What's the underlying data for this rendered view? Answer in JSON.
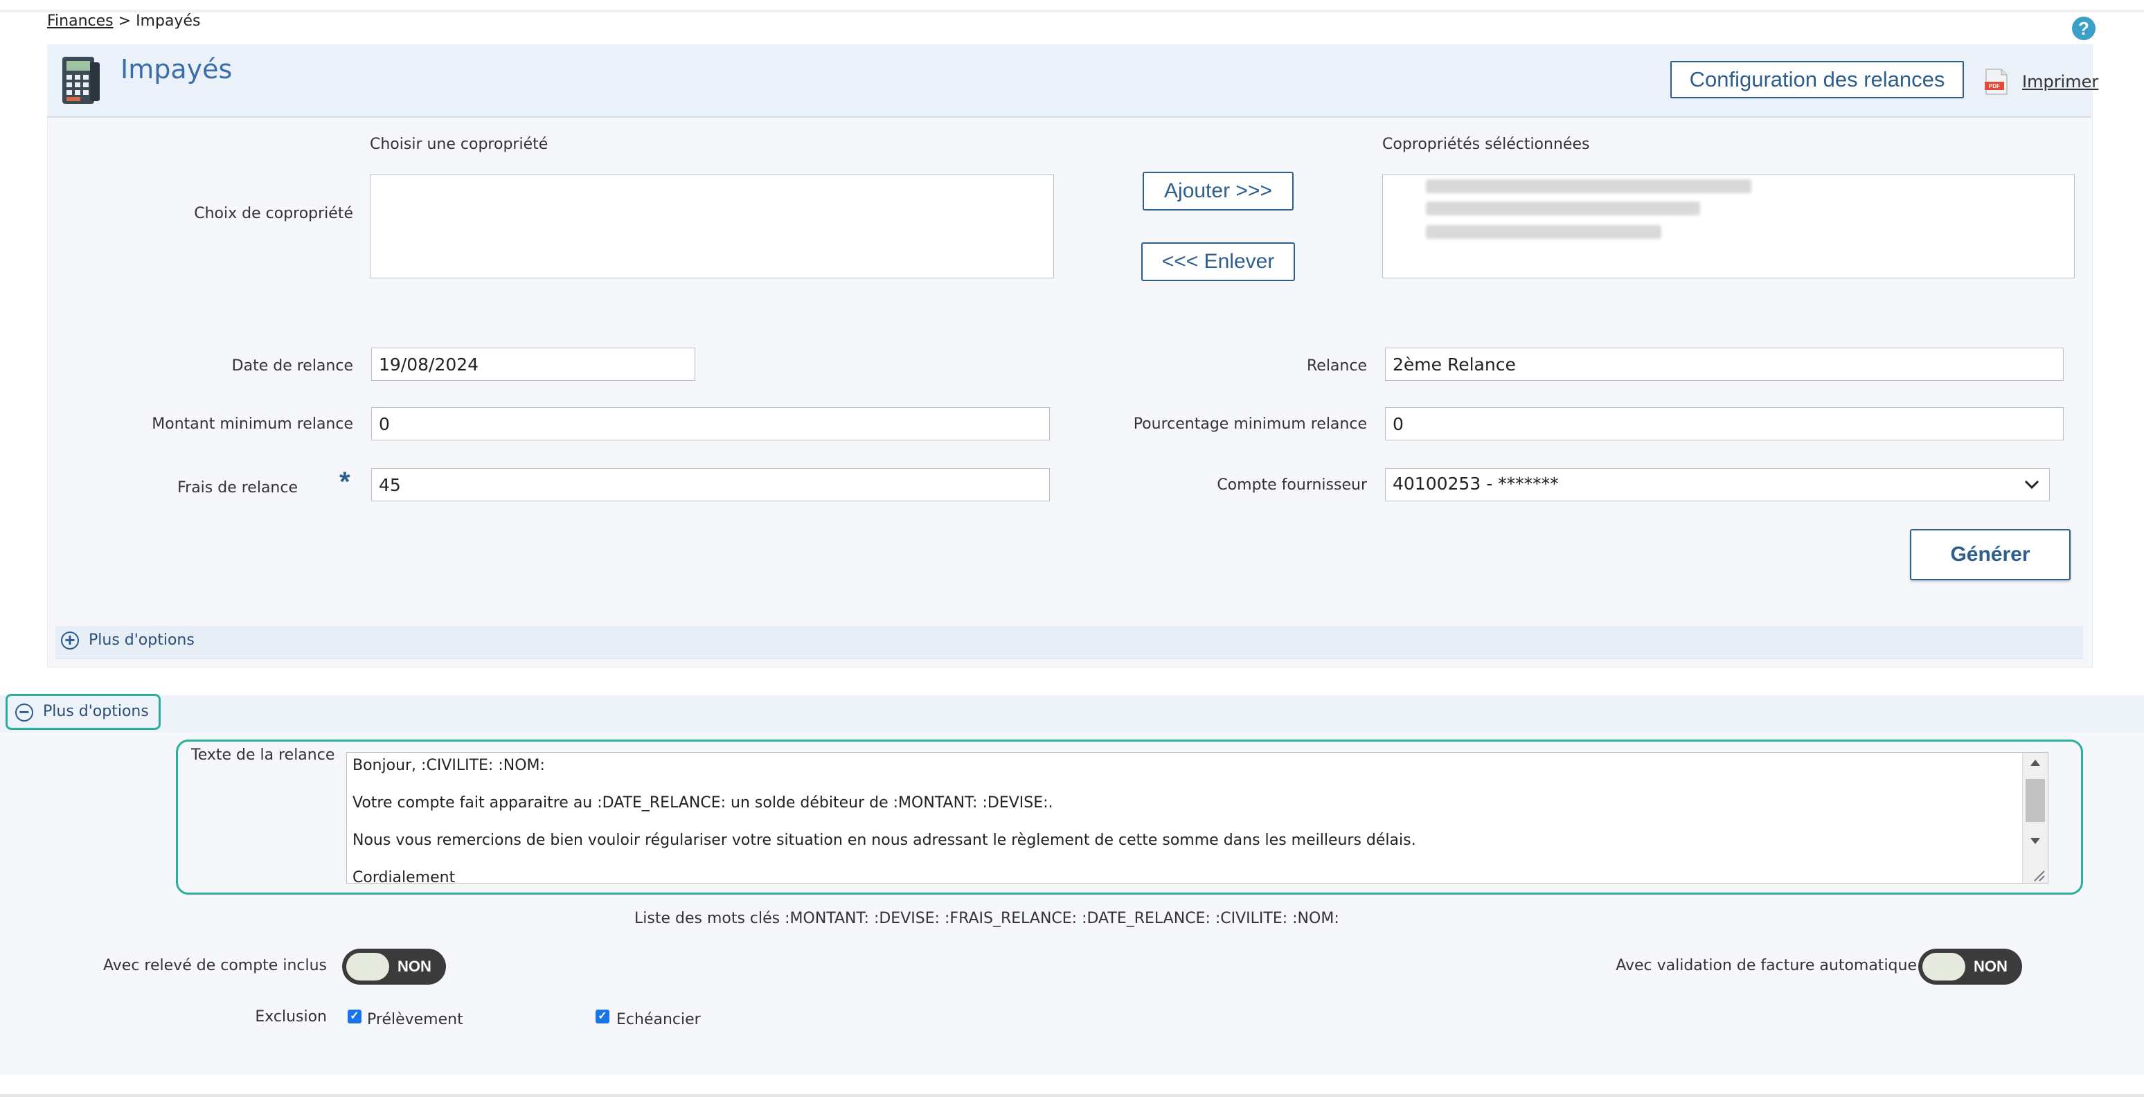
{
  "breadcrumb": {
    "root": "Finances",
    "separator": " > ",
    "current": "Impayés"
  },
  "header": {
    "title": "Impayés",
    "config_button": "Configuration des relances",
    "print_label": "Imprimer",
    "pdf_badge": "PDF"
  },
  "help": {
    "glyph": "?"
  },
  "coprop": {
    "choose_heading": "Choisir une copropriété",
    "selected_heading": "Copropriétés séléctionnées",
    "row_label": "Choix de copropriété",
    "add_button": "Ajouter >>>",
    "remove_button": "<<< Enlever"
  },
  "form": {
    "date_label": "Date de relance",
    "date_value": "19/08/2024",
    "relance_label": "Relance",
    "relance_value": "2ème Relance",
    "montant_label": "Montant minimum relance",
    "montant_value": "0",
    "pourcentage_label": "Pourcentage minimum relance",
    "pourcentage_value": "0",
    "frais_label": "Frais de relance",
    "required_marker": "*",
    "frais_value": "45",
    "compte_label": "Compte fournisseur",
    "compte_value": "40100253 - *******",
    "generate_button": "Générer"
  },
  "options": {
    "expand_label": "Plus d'options",
    "expand_glyph": "+",
    "collapse_label": "Plus d'options",
    "collapse_glyph": "−"
  },
  "relance_text": {
    "label": "Texte de la relance",
    "lines": [
      "Bonjour, :CIVILITE: :NOM:",
      "Votre compte fait apparaitre au :DATE_RELANCE: un solde débiteur de :MONTANT: :DEVISE:.",
      "Nous vous remercions de bien vouloir régulariser votre situation en nous adressant le règlement de cette somme dans les meilleurs délais.",
      "Cordialement"
    ],
    "keywords": "Liste des mots clés :MONTANT: :DEVISE: :FRAIS_RELANCE: :DATE_RELANCE: :CIVILITE: :NOM:"
  },
  "toggles": {
    "releve_label": "Avec relevé de compte inclus",
    "releve_state": "NON",
    "validation_label": "Avec validation de facture automatique",
    "validation_state": "NON"
  },
  "exclusion": {
    "label": "Exclusion",
    "prelevement_label": "Prélèvement",
    "prelevement_checked": true,
    "echeancier_label": "Echéancier",
    "echeancier_checked": true
  },
  "colors": {
    "accent": "#2e5e8e",
    "highlight": "#2bae9a",
    "title": "#3b6ea8"
  }
}
